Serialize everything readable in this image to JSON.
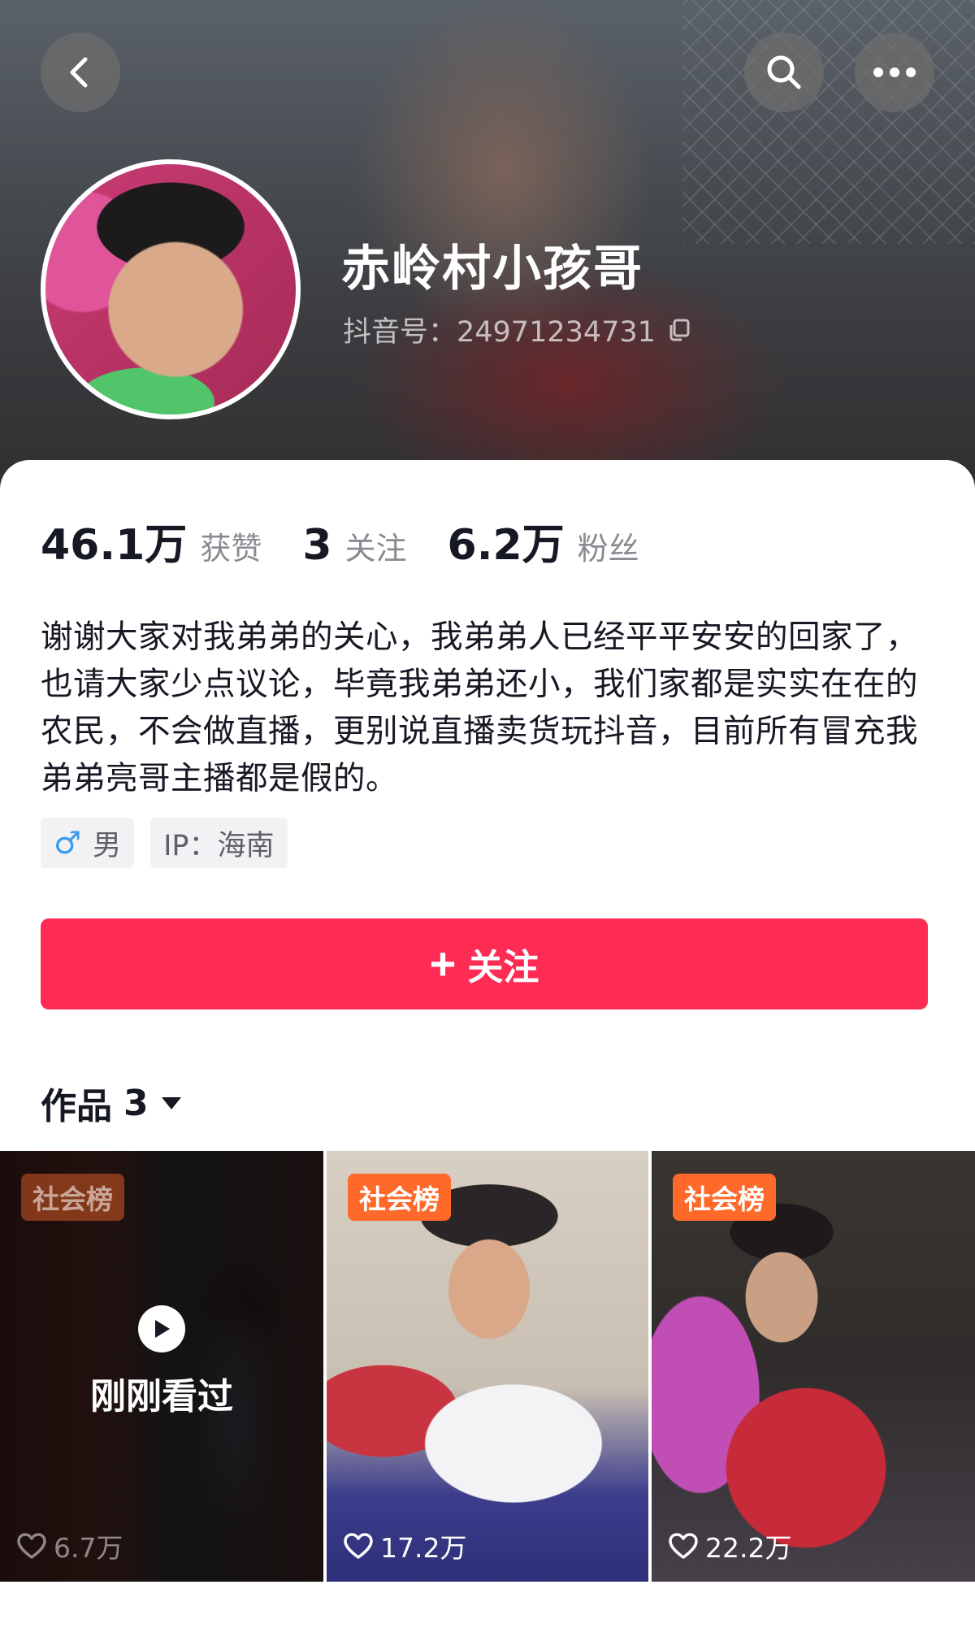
{
  "profile": {
    "name": "赤岭村小孩哥",
    "douyin_id": "抖音号：24971234731"
  },
  "stats": [
    {
      "value": "46.1万",
      "label": "获赞"
    },
    {
      "value": "3",
      "label": "关注"
    },
    {
      "value": "6.2万",
      "label": "粉丝"
    }
  ],
  "bio": "谢谢大家对我弟弟的关心，我弟弟人已经平平安安的回家了，也请大家少点议论，毕竟我弟弟还小，我们家都是实实在在的农民，不会做直播，更别说直播卖货玩抖音，目前所有冒充我弟弟亮哥主播都是假的。",
  "tags": {
    "gender_symbol": "♂",
    "gender": "男",
    "ip": "IP：海南"
  },
  "follow_button": {
    "icon": "plus-icon",
    "label": "关注"
  },
  "works_tab": {
    "label": "作品",
    "count": "3"
  },
  "videos": [
    {
      "badge": "社会榜",
      "likes": "6.7万",
      "overlay_label": "刚刚看过"
    },
    {
      "badge": "社会榜",
      "likes": "17.2万"
    },
    {
      "badge": "社会榜",
      "likes": "22.2万"
    }
  ],
  "colors": {
    "accent": "#fe2c55",
    "badge": "#ff6a2a",
    "male": "#3a9bf0"
  }
}
